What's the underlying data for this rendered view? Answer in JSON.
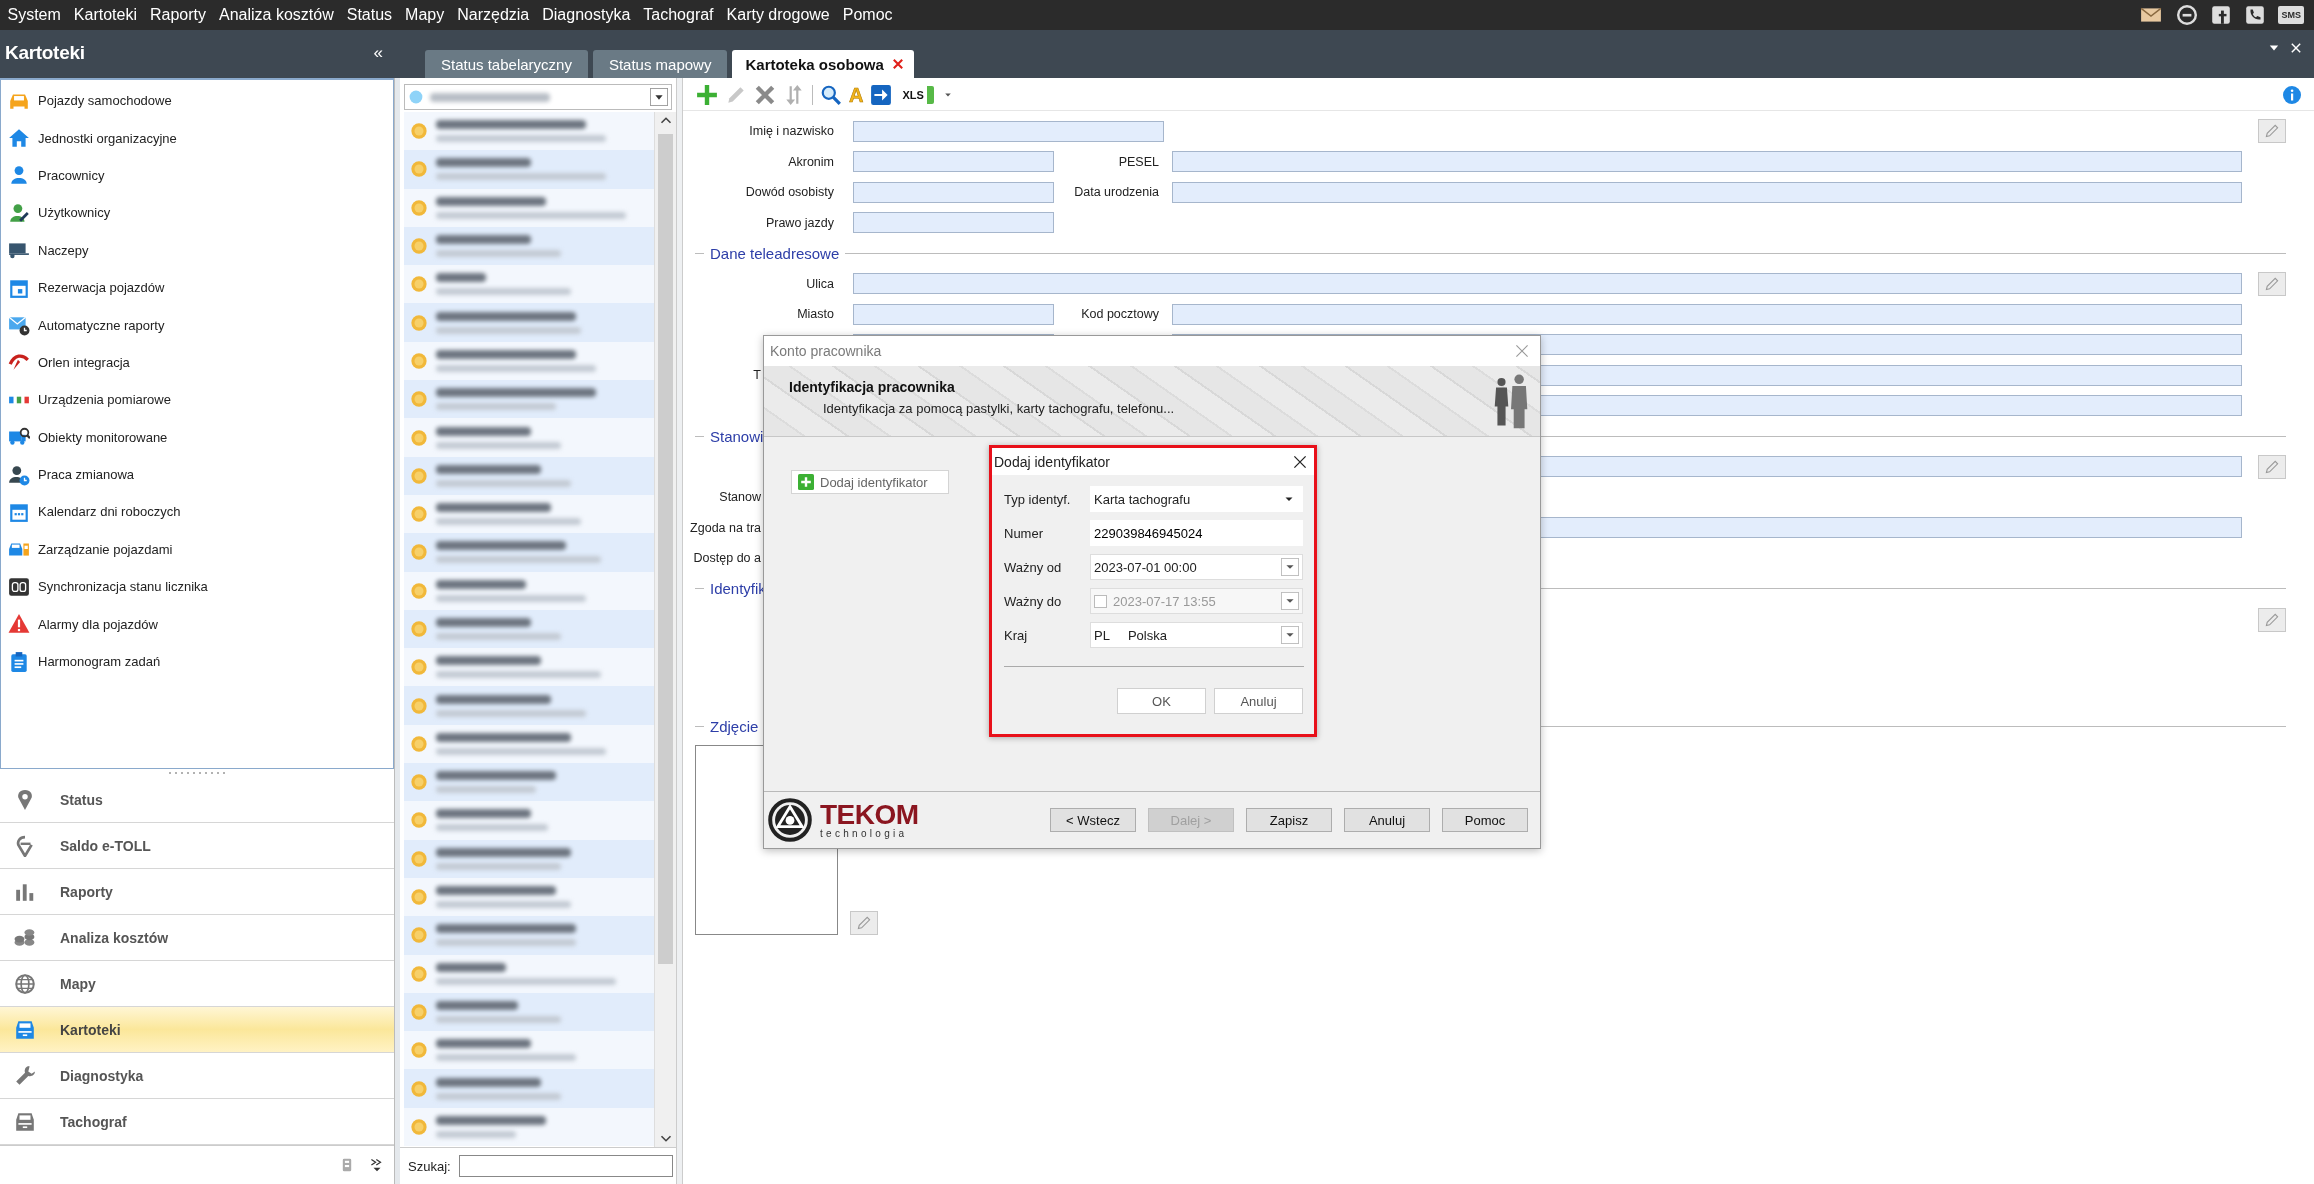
{
  "menu": [
    "System",
    "Kartoteki",
    "Raporty",
    "Analiza kosztów",
    "Status",
    "Mapy",
    "Narzędzia",
    "Diagnostyka",
    "Tachograf",
    "Karty drogowe",
    "Pomoc"
  ],
  "sms_label": "SMS",
  "left_panel": {
    "title": "Kartoteki",
    "collapse": "«",
    "items": [
      "Pojazdy samochodowe",
      "Jednostki organizacyjne",
      "Pracownicy",
      "Użytkownicy",
      "Naczepy",
      "Rezerwacja pojazdów",
      "Automatyczne raporty",
      "Orlen integracja",
      "Urządzenia pomiarowe",
      "Obiekty monitorowane",
      "Praca zmianowa",
      "Kalendarz dni roboczych",
      "Zarządzanie pojazdami",
      "Synchronizacja stanu licznika",
      "Alarmy dla pojazdów",
      "Harmonogram zadań"
    ],
    "nav": [
      {
        "label": "Status",
        "selected": false
      },
      {
        "label": "Saldo e-TOLL",
        "selected": false
      },
      {
        "label": "Raporty",
        "selected": false
      },
      {
        "label": "Analiza kosztów",
        "selected": false
      },
      {
        "label": "Mapy",
        "selected": false
      },
      {
        "label": "Kartoteki",
        "selected": true
      },
      {
        "label": "Diagnostyka",
        "selected": false
      },
      {
        "label": "Tachograf",
        "selected": false
      }
    ]
  },
  "tabs": [
    {
      "label": "Status tabelaryczny",
      "selected": false,
      "closable": false
    },
    {
      "label": "Status mapowy",
      "selected": false,
      "closable": false
    },
    {
      "label": "Kartoteka osobowa",
      "selected": true,
      "closable": true
    }
  ],
  "employee_list": {
    "rows": [
      {
        "shaded": false
      },
      {
        "shaded": true
      },
      {
        "shaded": false
      },
      {
        "shaded": true
      },
      {
        "shaded": false
      },
      {
        "shaded": true
      },
      {
        "shaded": false
      },
      {
        "shaded": true
      },
      {
        "shaded": false
      },
      {
        "shaded": true
      },
      {
        "shaded": false
      },
      {
        "shaded": true
      },
      {
        "shaded": false
      },
      {
        "shaded": true
      },
      {
        "shaded": false
      },
      {
        "shaded": true
      },
      {
        "shaded": false
      },
      {
        "shaded": true
      },
      {
        "shaded": false
      },
      {
        "shaded": true
      },
      {
        "shaded": false
      },
      {
        "shaded": true
      },
      {
        "shaded": false
      },
      {
        "shaded": true
      },
      {
        "shaded": false
      },
      {
        "shaded": true
      },
      {
        "shaded": false
      }
    ],
    "search_label": "Szukaj:"
  },
  "toolbar": [
    {
      "kind": "add"
    },
    {
      "kind": "edit"
    },
    {
      "kind": "delete"
    },
    {
      "kind": "move"
    },
    {
      "kind": "separator"
    },
    {
      "kind": "search"
    },
    {
      "kind": "letter",
      "label": "A"
    },
    {
      "kind": "export"
    },
    {
      "kind": "xls",
      "label": "XLS"
    },
    {
      "kind": "caret"
    }
  ],
  "form": {
    "rows": [
      {
        "kind": "medium",
        "label": "Imię i nazwisko",
        "edit_button": true
      },
      {
        "kind": "pair",
        "label": "Akronim",
        "label2": "PESEL"
      },
      {
        "kind": "pair",
        "label": "Dowód osobisty",
        "label2": "Data urodzenia"
      },
      {
        "kind": "short",
        "label": "Prawo jazdy"
      },
      {
        "kind": "section",
        "title": "Dane teleadresowe"
      },
      {
        "kind": "wide",
        "label": "Ulica",
        "edit_button": true
      },
      {
        "kind": "pair",
        "label": "Miasto",
        "label2": "Kod pocztowy"
      },
      {
        "kind": "pair"
      },
      {
        "kind": "wide",
        "label": "T",
        "clipped": true
      },
      {
        "kind": "wide"
      },
      {
        "kind": "section",
        "title": "Stanowi"
      },
      {
        "kind": "wide",
        "edit_button": true
      },
      {
        "kind": "blank",
        "label": "Stanow",
        "clipped": true
      },
      {
        "kind": "wide",
        "label": "Zgoda na tra",
        "clipped": true
      },
      {
        "kind": "blank",
        "label": "Dostęp do a",
        "clipped": true
      },
      {
        "kind": "section",
        "title": "Identyfik"
      },
      {
        "kind": "edit_only",
        "edit_button": true
      },
      {
        "kind": "section",
        "title": "Zdjęcie"
      },
      {
        "kind": "photo",
        "edit_button": true
      }
    ]
  },
  "dialog": {
    "title": "Konto pracownika",
    "heading": "Identyfikacja pracownika",
    "subheading": "Identyfikacja za pomocą pastylki, karty tachografu, telefonu...",
    "add_button": "Dodaj identyfikator",
    "logo": {
      "name": "TEKOM",
      "tagline": "technologia"
    },
    "buttons": [
      {
        "label": "< Wstecz",
        "disabled": false
      },
      {
        "label": "Dalej >",
        "disabled": true
      },
      {
        "label": "Zapisz",
        "disabled": false
      },
      {
        "label": "Anuluj",
        "disabled": false
      },
      {
        "label": "Pomoc",
        "disabled": false
      }
    ]
  },
  "subdialog": {
    "title": "Dodaj identyfikator",
    "fields": [
      {
        "kind": "combo",
        "label": "Typ identyf.",
        "value": "Karta tachografu",
        "disabled": false
      },
      {
        "kind": "text",
        "label": "Numer",
        "value": "229039846945024",
        "disabled": false
      },
      {
        "kind": "datetime",
        "label": "Ważny od",
        "value": "2023-07-01 00:00",
        "disabled": false
      },
      {
        "kind": "datetime_optional",
        "label": "Ważny do",
        "value": "2023-07-17 13:55",
        "checked": false,
        "disabled": true
      },
      {
        "kind": "country",
        "label": "Kraj",
        "code": "PL",
        "value": "Polska",
        "disabled": false
      }
    ],
    "buttons": [
      {
        "label": "OK"
      },
      {
        "label": "Anuluj"
      }
    ]
  }
}
